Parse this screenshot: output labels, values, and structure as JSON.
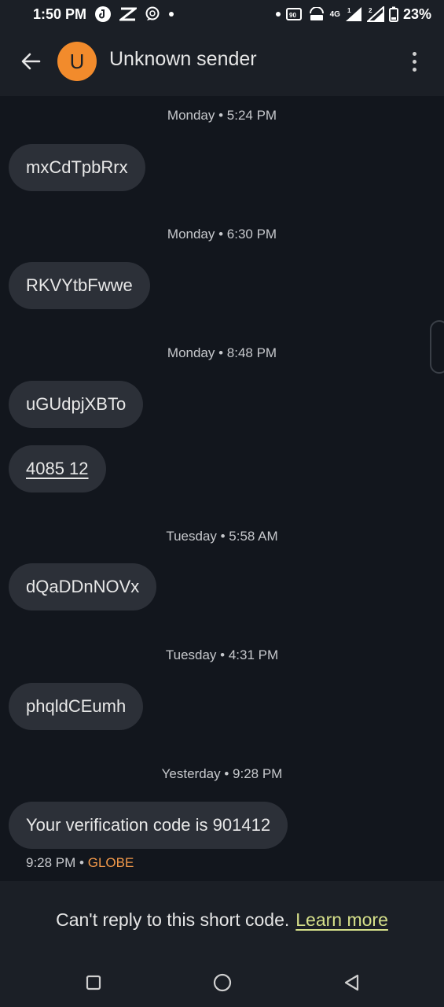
{
  "status_bar": {
    "time": "1:50 PM",
    "network": "4G",
    "sim1": "1",
    "sim2": "2",
    "battery": "23%",
    "icons": [
      "tiktok-icon",
      "capcut-icon",
      "chat-bubble-icon",
      "dot-icon",
      "data-saver-icon",
      "volte-icon",
      "signal-icon",
      "battery-icon"
    ]
  },
  "header": {
    "avatar_letter": "U",
    "avatar_color": "#f28b2c",
    "contact_name": "Unknown sender"
  },
  "messages": [
    {
      "timestamp": "Monday • 5:24 PM",
      "bubbles": [
        "mxCdTpbRrx"
      ]
    },
    {
      "timestamp": "Monday • 6:30 PM",
      "bubbles": [
        "RKVYtbFwwe"
      ]
    },
    {
      "timestamp": "Monday • 8:48 PM",
      "bubbles": [
        "uGUdpjXBTo",
        "4085 12"
      ]
    },
    {
      "timestamp": "Tuesday • 5:58 AM",
      "bubbles": [
        "dQaDDnNOVx"
      ]
    },
    {
      "timestamp": "Tuesday • 4:31 PM",
      "bubbles": [
        "phqldCEumh"
      ]
    },
    {
      "timestamp": "Yesterday • 9:28 PM",
      "bubbles": [
        "Your verification code is 901412"
      ]
    }
  ],
  "last_meta": {
    "time": "9:28 PM",
    "separator": "•",
    "sender": "GLOBE"
  },
  "footer": {
    "notice": "Can't reply to this short code.",
    "link": "Learn more",
    "link_color": "#d6e08a"
  },
  "nav": {
    "icons": [
      "recents-icon",
      "home-icon",
      "back-nav-icon"
    ]
  }
}
